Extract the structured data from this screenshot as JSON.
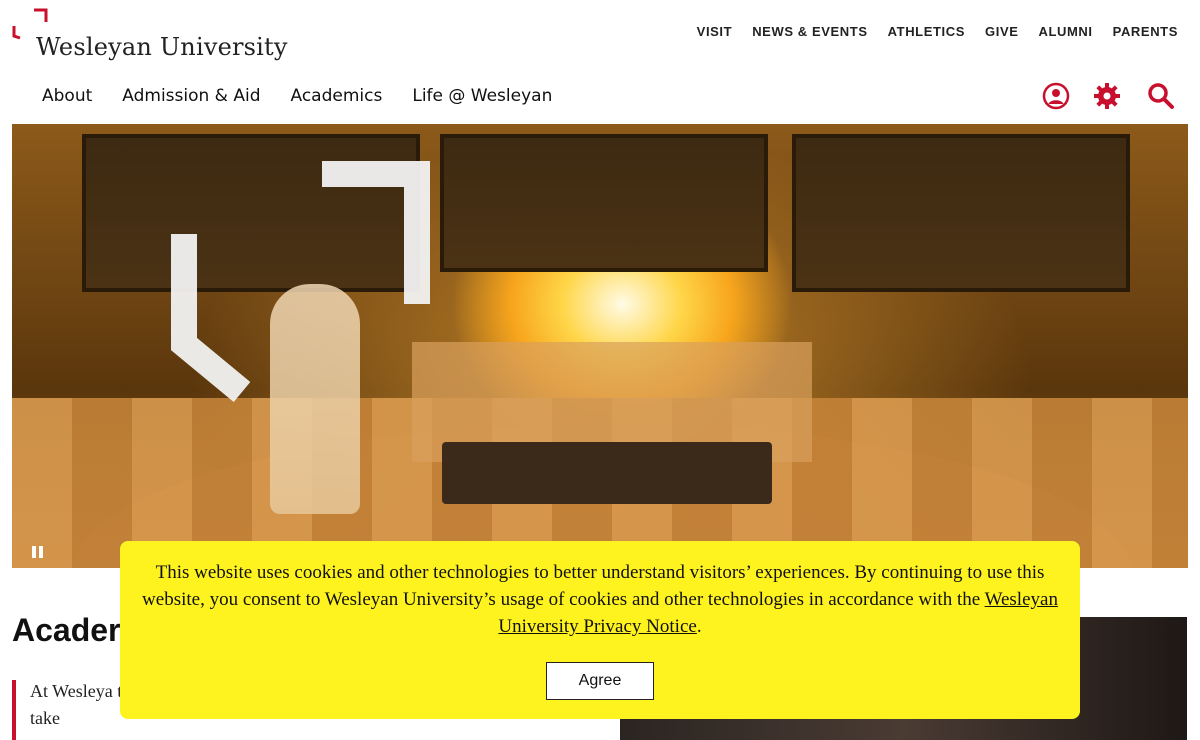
{
  "header": {
    "logo_text": "Wesleyan University",
    "utility_nav": [
      "VISIT",
      "NEWS & EVENTS",
      "ATHLETICS",
      "GIVE",
      "ALUMNI",
      "PARENTS"
    ],
    "main_nav": [
      "About",
      "Admission & Aid",
      "Academics",
      "Life @ Wesleyan"
    ],
    "icons": [
      "user-icon",
      "gear-icon",
      "search-icon"
    ]
  },
  "hero": {
    "media": "video",
    "controls": [
      "pause-icon"
    ]
  },
  "content": {
    "section_title": "Acader",
    "intro_text": "At Wesleya                                     think creatively, become intellectually agile, and take"
  },
  "cookie_banner": {
    "text_before": "This website uses cookies and other technologies to better understand visitors’ experiences. By continuing to use this website, you consent to Wesleyan University’s usage of cookies and other technologies in accordance with the ",
    "link_text": "Wesleyan University Privacy Notice",
    "text_after": ".",
    "agree_label": "Agree"
  },
  "colors": {
    "brand_red": "#c8102e",
    "banner_yellow": "#fef31e"
  }
}
